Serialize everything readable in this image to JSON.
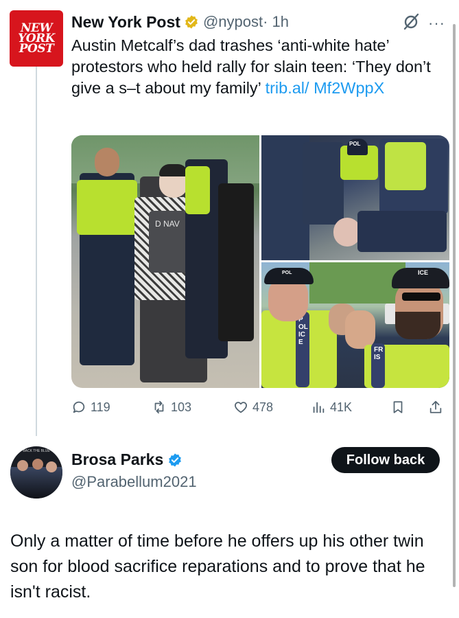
{
  "quoted_tweet": {
    "logo_text": [
      "NEW",
      "YORK",
      "POST"
    ],
    "author": "New York Post",
    "handle": "@nypost",
    "time": "· 1h",
    "text": "Austin Metcalf’s dad trashes ‘anti-white hate’ protestors who held rally for slain teen: ‘They don’t give a s–t about my family’ ",
    "link": "trib.al/ Mf2WppX",
    "media_overlay_text": {
      "main_shirt": "D NAV",
      "top_cap": "POL",
      "bottom_cap": "ICE",
      "bottom_cap_2": "POL",
      "vest_left": "POLICE",
      "vest_right": "FRIS"
    },
    "stats": {
      "replies": "119",
      "reposts": "103",
      "likes": "478",
      "views": "41K"
    },
    "icons": {
      "verified": "gold-check-badge-icon",
      "grok": "grok-icon",
      "more": "more-icon",
      "reply": "reply-icon",
      "repost": "repost-icon",
      "like": "heart-icon",
      "views": "views-icon",
      "bookmark": "bookmark-icon",
      "share": "share-icon"
    }
  },
  "reply": {
    "avatar_text": "BACK THE BLUE",
    "author": "Brosa Parks",
    "handle": "@Parabellum2021",
    "follow_label": "Follow back",
    "text": "Only a matter of time before he offers up his other twin son for blood sacrifice reparations and to prove that he isn't racist."
  },
  "colors": {
    "nypost_red": "#d7151d",
    "link_blue": "#1d9bf0",
    "verified_gold": "#e2b719",
    "verified_blue": "#1d9bf0",
    "secondary_text": "#536471"
  }
}
